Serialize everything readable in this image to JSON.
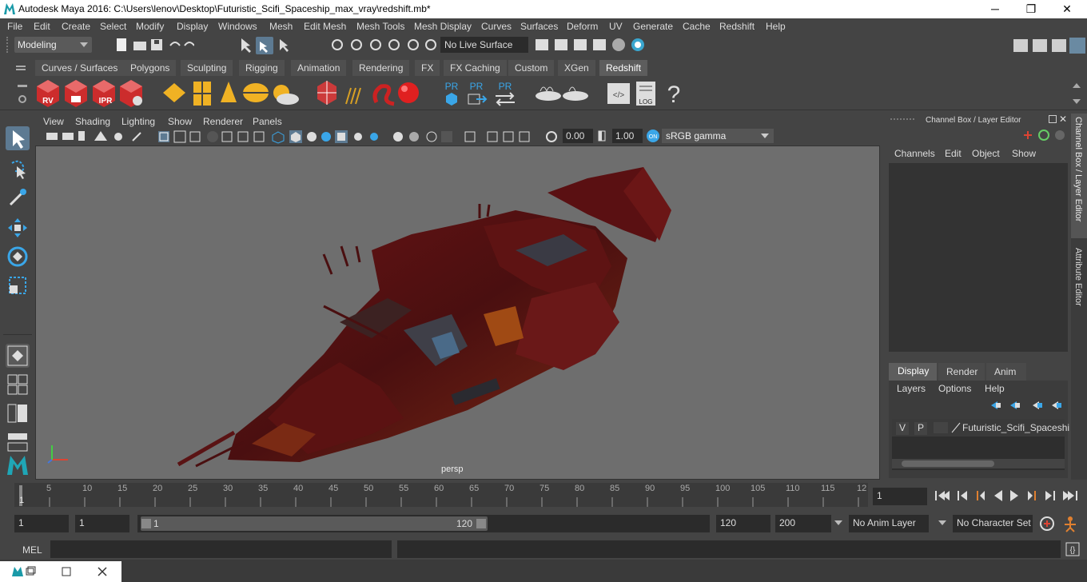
{
  "window": {
    "title": "Autodesk Maya 2016: C:\\Users\\lenov\\Desktop\\Futuristic_Scifi_Spaceship_max_vray\\redshift.mb*",
    "minimize": "─",
    "maximize": "❐",
    "close": "✕"
  },
  "menubar": {
    "items": [
      "File",
      "Edit",
      "Create",
      "Select",
      "Modify",
      "Display",
      "Windows",
      "Mesh",
      "Edit Mesh",
      "Mesh Tools",
      "Mesh Display",
      "Curves",
      "Surfaces",
      "Deform",
      "UV",
      "Generate",
      "Cache",
      "Redshift",
      "Help"
    ]
  },
  "statusline": {
    "mode": "Modeling",
    "live_surface": "No Live Surface"
  },
  "shelf_tabs": {
    "items": [
      "Curves / Surfaces",
      "Polygons",
      "Sculpting",
      "Rigging",
      "Animation",
      "Rendering",
      "FX",
      "FX Caching",
      "Custom",
      "XGen",
      "Redshift"
    ],
    "active": "Redshift"
  },
  "shelf": {
    "rv_label": "RV",
    "ipr_label": "IPR",
    "pr1": "PR",
    "pr2": "PR",
    "pr3": "PR",
    "log_label": "LOG",
    "help_glyph": "?"
  },
  "viewport": {
    "menu": [
      "View",
      "Shading",
      "Lighting",
      "Show",
      "Renderer",
      "Panels"
    ],
    "near_value": "0.00",
    "far_value": "1.00",
    "color_space": "sRGB gamma",
    "camera_label": "persp"
  },
  "channelbox": {
    "title": "Channel Box / Layer Editor",
    "menu": [
      "Channels",
      "Edit",
      "Object",
      "Show"
    ],
    "layer_tabs": [
      "Display",
      "Render",
      "Anim"
    ],
    "active_layer_tab": "Display",
    "layer_menu": [
      "Layers",
      "Options",
      "Help"
    ],
    "layer_row": {
      "v": "V",
      "p": "P",
      "name": "Futuristic_Scifi_Spaceshi"
    }
  },
  "side_tabs": [
    "Channel Box / Layer Editor",
    "Attribute Editor"
  ],
  "timeslider": {
    "ticks": [
      "5",
      "10",
      "15",
      "20",
      "25",
      "30",
      "35",
      "40",
      "45",
      "50",
      "55",
      "60",
      "65",
      "70",
      "75",
      "80",
      "85",
      "90",
      "95",
      "100",
      "105",
      "110",
      "115",
      "12"
    ],
    "current_marker": "1",
    "current_frame": "1"
  },
  "rangeslider": {
    "start_field": "1",
    "start_field2": "1",
    "range_start": "1",
    "range_end": "120",
    "end_field": "120",
    "end_field2": "200",
    "anim_layer": "No Anim Layer",
    "character_set": "No Character Set"
  },
  "cmdline": {
    "label": "MEL"
  }
}
